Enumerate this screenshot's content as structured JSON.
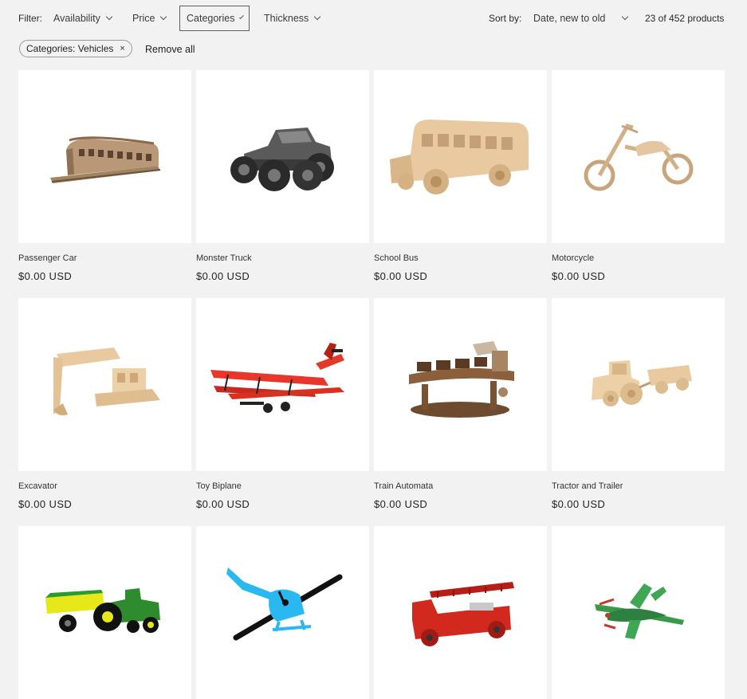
{
  "filter": {
    "label": "Filter:",
    "buttons": [
      {
        "label": "Availability"
      },
      {
        "label": "Price"
      },
      {
        "label": "Categories"
      },
      {
        "label": "Thickness"
      }
    ]
  },
  "sort": {
    "label": "Sort by:",
    "selected": "Date, new to old"
  },
  "count": "23 of 452 products",
  "active_filter": {
    "pill": "Categories: Vehicles",
    "remove_icon": "×",
    "remove_all": "Remove all"
  },
  "products": [
    {
      "title": "Passenger Car",
      "price": "$0.00 USD",
      "icon": "passenger-car-icon"
    },
    {
      "title": "Monster Truck",
      "price": "$0.00 USD",
      "icon": "monster-truck-icon"
    },
    {
      "title": "School Bus",
      "price": "$0.00 USD",
      "icon": "school-bus-icon"
    },
    {
      "title": "Motorcycle",
      "price": "$0.00 USD",
      "icon": "motorcycle-icon"
    },
    {
      "title": "Excavator",
      "price": "$0.00 USD",
      "icon": "excavator-icon"
    },
    {
      "title": "Toy Biplane",
      "price": "$0.00 USD",
      "icon": "biplane-icon"
    },
    {
      "title": "Train Automata",
      "price": "$0.00 USD",
      "icon": "train-automata-icon"
    },
    {
      "title": "Tractor and Trailer",
      "price": "$0.00 USD",
      "icon": "tractor-trailer-icon"
    },
    {
      "title": "",
      "price": "",
      "icon": "green-tractor-wagon-icon"
    },
    {
      "title": "",
      "price": "",
      "icon": "helicopter-icon"
    },
    {
      "title": "",
      "price": "",
      "icon": "fire-truck-icon"
    },
    {
      "title": "",
      "price": "",
      "icon": "fighter-plane-icon"
    }
  ],
  "colors": {
    "page_bg": "#f2f2f2",
    "card_bg": "#ffffff",
    "wood": "#e6c9a3",
    "dark_wood": "#8b5e3c",
    "red": "#e23a2a",
    "green": "#2e8b2e",
    "cyan": "#2ab8f0"
  }
}
